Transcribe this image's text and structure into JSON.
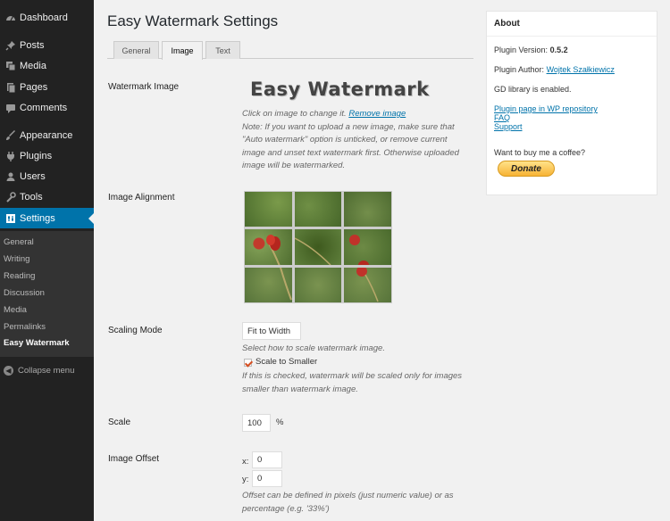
{
  "sidebar": {
    "items": [
      {
        "label": "Dashboard",
        "icon": "dashboard-icon"
      },
      {
        "label": "Posts",
        "icon": "pin-icon"
      },
      {
        "label": "Media",
        "icon": "media-icon"
      },
      {
        "label": "Pages",
        "icon": "pages-icon"
      },
      {
        "label": "Comments",
        "icon": "comments-icon"
      },
      {
        "label": "Appearance",
        "icon": "brush-icon"
      },
      {
        "label": "Plugins",
        "icon": "plug-icon"
      },
      {
        "label": "Users",
        "icon": "users-icon"
      },
      {
        "label": "Tools",
        "icon": "wrench-icon"
      },
      {
        "label": "Settings",
        "icon": "settings-icon"
      }
    ],
    "submenu": [
      "General",
      "Writing",
      "Reading",
      "Discussion",
      "Media",
      "Permalinks",
      "Easy Watermark"
    ],
    "collapse_label": "Collapse menu"
  },
  "page": {
    "title": "Easy Watermark Settings",
    "tabs": [
      "General",
      "Image",
      "Text"
    ],
    "active_tab": "Image"
  },
  "watermark_image": {
    "label": "Watermark Image",
    "preview_text": "Easy Watermark",
    "click_hint": "Click on image to change it.",
    "remove_link": "Remove image",
    "note_lines": [
      "Note: If you want to upload a new image, make sure that",
      "\"Auto watermark\" option is unticked, or remove current",
      "image and unset text watermark first. Otherwise uploaded",
      "image will be watermarked."
    ]
  },
  "alignment": {
    "label": "Image Alignment"
  },
  "scaling": {
    "label": "Scaling Mode",
    "value": "Fit to Width",
    "hint": "Select how to scale watermark image.",
    "checkbox_label": "Scale to Smaller",
    "checked": true,
    "note_lines": [
      "If this is checked, watermark will be scaled only for images",
      "smaller than watermark image."
    ]
  },
  "scale": {
    "label": "Scale",
    "value": "100",
    "unit": "%"
  },
  "offset": {
    "label": "Image Offset",
    "x_label": "x:",
    "x_value": "0",
    "y_label": "y:",
    "y_value": "0",
    "note_lines": [
      "Offset can be defined in pixels (just numeric value) or as",
      "percentage (e.g. '33%')"
    ]
  },
  "about": {
    "title": "About",
    "version_label": "Plugin Version:",
    "version": "0.5.2",
    "author_label": "Plugin Author:",
    "author": "Wojtek Szałkiewicz",
    "gd": "GD library is enabled.",
    "links": [
      "Plugin page in WP repository",
      "FAQ",
      "Support"
    ],
    "coffee": "Want to buy me a coffee?",
    "donate": "Donate"
  },
  "colors": {
    "accent": "#0073aa",
    "sidebar": "#222222",
    "donate": "#f7b335"
  }
}
